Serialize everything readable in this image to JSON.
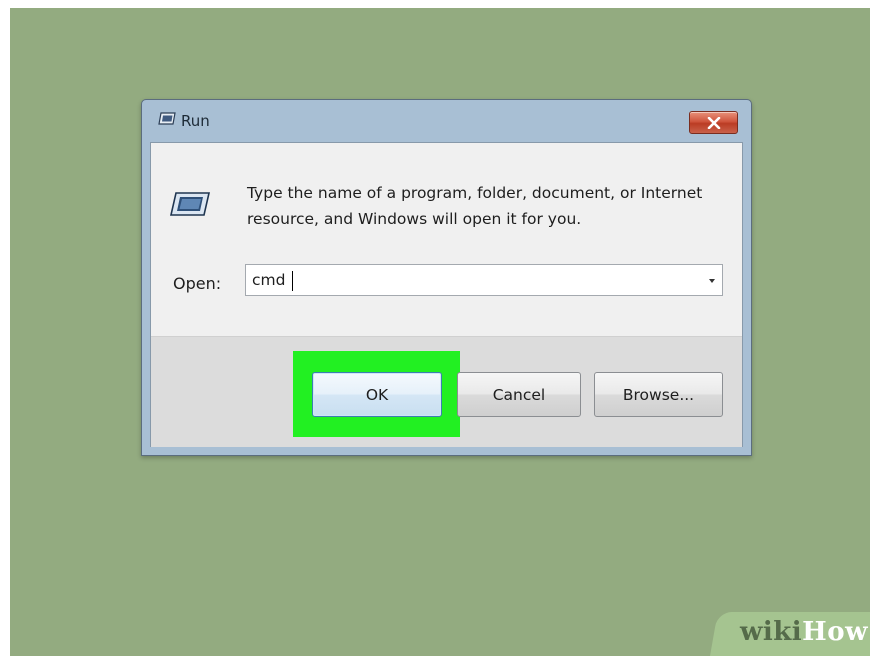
{
  "window": {
    "title": "Run",
    "close_icon": "close-icon"
  },
  "dialog": {
    "description": "Type the name of a program, folder, document, or Internet resource, and Windows will open it for you.",
    "open_label": "Open:",
    "input_value": "cmd",
    "app_icon": "run-icon"
  },
  "buttons": {
    "ok": "OK",
    "cancel": "Cancel",
    "browse": "Browse..."
  },
  "watermark": {
    "part1": "wiki",
    "part2": "How"
  },
  "colors": {
    "background": "#93ab80",
    "highlight": "#22f022",
    "close_button": "#c9452f"
  }
}
